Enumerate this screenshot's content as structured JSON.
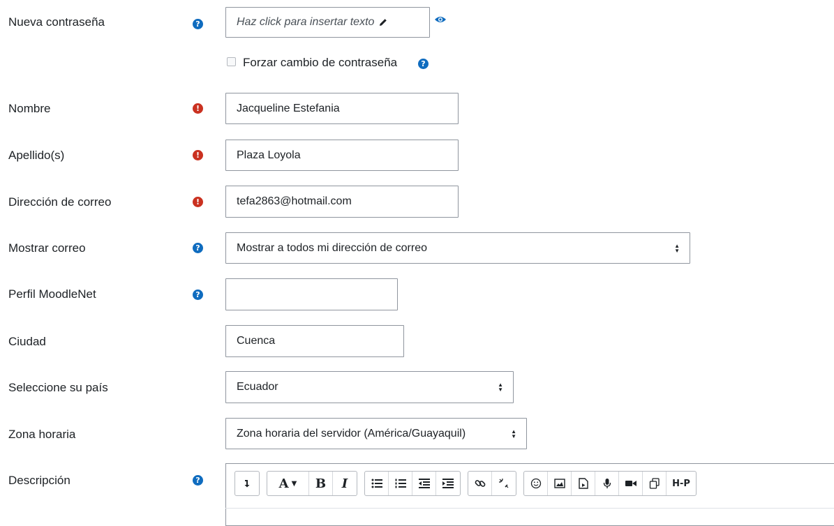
{
  "form": {
    "password": {
      "label": "Nueva contraseña",
      "placeholder": "Haz click para insertar texto"
    },
    "force_change": {
      "label": "Forzar cambio de contraseña"
    },
    "firstname": {
      "label": "Nombre",
      "value": "Jacqueline Estefania"
    },
    "lastname": {
      "label": "Apellido(s)",
      "value": "Plaza Loyola"
    },
    "email": {
      "label": "Dirección de correo",
      "value": "tefa2863@hotmail.com"
    },
    "maildisplay": {
      "label": "Mostrar correo",
      "value": "Mostrar a todos mi dirección de correo"
    },
    "moodlenet": {
      "label": "Perfil MoodleNet",
      "value": ""
    },
    "city": {
      "label": "Ciudad",
      "value": "Cuenca"
    },
    "country": {
      "label": "Seleccione su país",
      "value": "Ecuador"
    },
    "timezone": {
      "label": "Zona horaria",
      "value": "Zona horaria del servidor (América/Guayaquil)"
    },
    "description": {
      "label": "Descripción"
    }
  },
  "icons": {
    "help": "question-circle-icon",
    "required": "exclamation-circle-icon",
    "reveal": "eye-icon",
    "edit": "pencil-icon"
  },
  "editor_toolbar": {
    "h5p_label": "H-P"
  },
  "colors": {
    "help": "#0f6cbf",
    "required": "#ca3120"
  }
}
